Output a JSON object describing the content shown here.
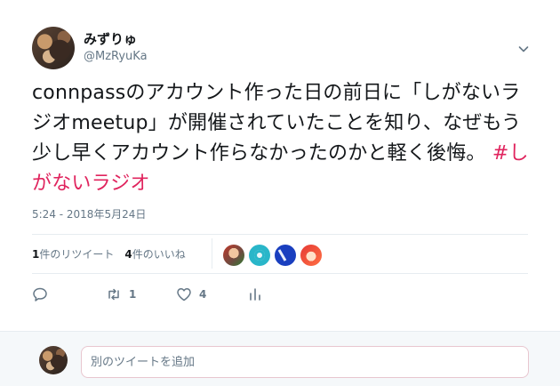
{
  "user": {
    "display_name": "みずりゅ",
    "handle": "@MzRyuKa"
  },
  "tweet": {
    "text": "connpassのアカウント作った日の前日に「しがないラジオmeetup」が開催されていたことを知り、なぜもう少し早くアカウント作らなかったのかと軽く後悔。",
    "hashtag": "#しがないラジオ",
    "timestamp": "5:24 - 2018年5月24日"
  },
  "stats": {
    "retweets_count": "1",
    "retweets_label": "件のリツイート",
    "likes_count": "4",
    "likes_label": "件のいいね"
  },
  "actions": {
    "retweet_count": "1",
    "like_count": "4"
  },
  "reply": {
    "placeholder": "別のツイートを追加"
  },
  "colors": {
    "hashtag": "#e0245e",
    "secondary_text": "#657786",
    "divider": "#e6ecf0"
  },
  "icons": [
    "chevron-down-icon",
    "reply-icon",
    "retweet-icon",
    "heart-icon",
    "analytics-icon"
  ]
}
